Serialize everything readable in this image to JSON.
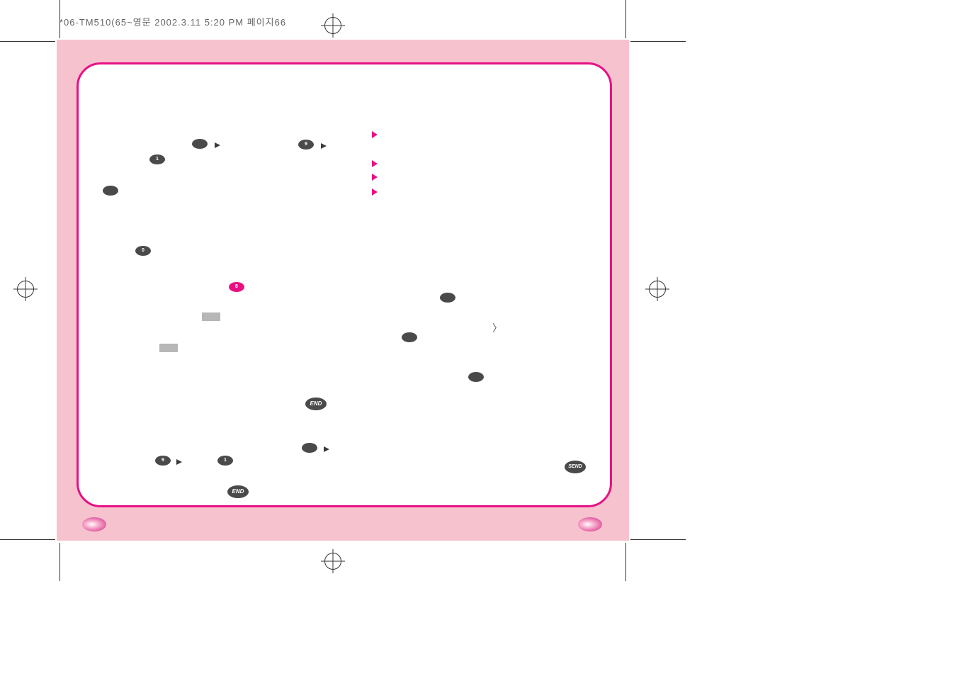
{
  "header": {
    "slug": "*06-TM510(65~영문 2002.3.11 5:20 PM 페이지66"
  },
  "keys": {
    "one": "1",
    "zero": "0",
    "eight": "8",
    "nine": "9",
    "end": "END",
    "send": "SEND",
    "blank": ""
  }
}
